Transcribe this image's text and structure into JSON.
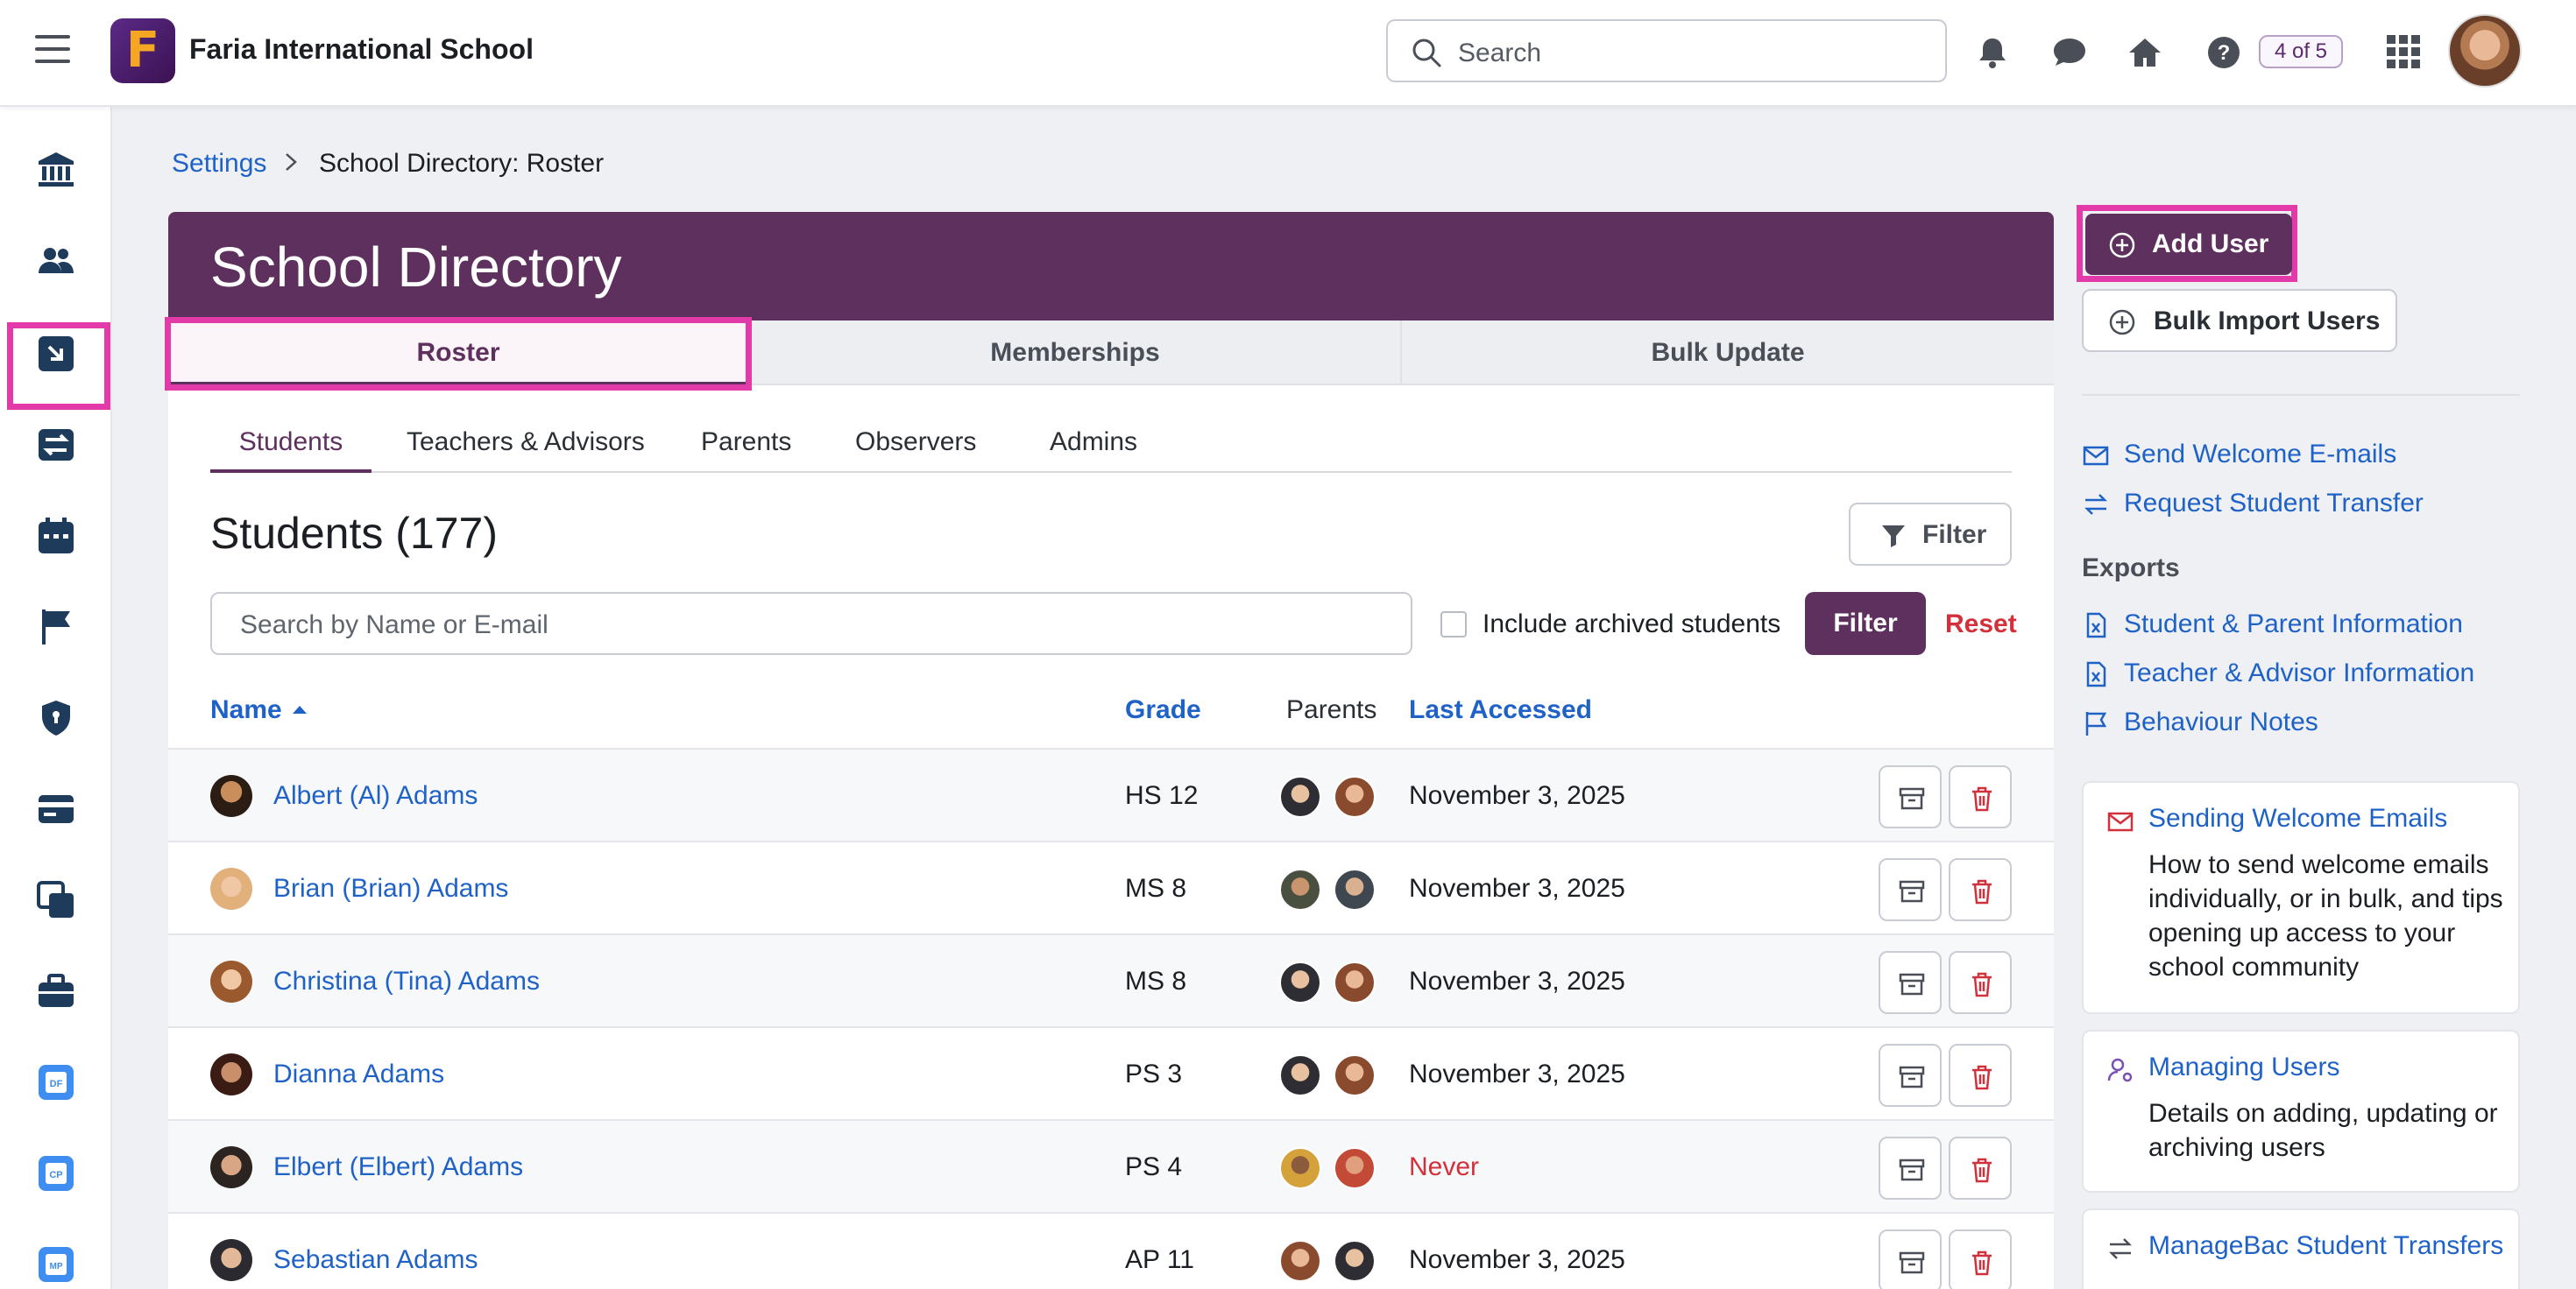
{
  "header": {
    "school_name": "Faria International School",
    "logo_letter": "F",
    "search_placeholder": "Search",
    "progress_badge": "4 of 5"
  },
  "breadcrumb": {
    "parent": "Settings",
    "current": "School Directory: Roster"
  },
  "directory": {
    "title": "School Directory",
    "tabs": [
      "Roster",
      "Memberships",
      "Bulk Update"
    ],
    "active_tab": "Roster",
    "subtabs": [
      "Students",
      "Teachers & Advisors",
      "Parents",
      "Observers",
      "Admins"
    ],
    "active_subtab": "Students",
    "heading": "Students (177)",
    "filter_button": "Filter",
    "search_placeholder": "Search by Name or E-mail",
    "include_archived_label": "Include archived students",
    "include_archived_checked": false,
    "apply_filter_button": "Filter",
    "reset_link": "Reset"
  },
  "table": {
    "columns": {
      "name": "Name",
      "grade": "Grade",
      "parents": "Parents",
      "last_accessed": "Last Accessed"
    },
    "sort": "name-ascending",
    "rows": [
      {
        "name": "Albert (Al) Adams",
        "grade": "HS 12",
        "last_accessed": "November 3, 2025",
        "never": false
      },
      {
        "name": "Brian (Brian) Adams",
        "grade": "MS 8",
        "last_accessed": "November 3, 2025",
        "never": false
      },
      {
        "name": "Christina (Tina) Adams",
        "grade": "MS 8",
        "last_accessed": "November 3, 2025",
        "never": false
      },
      {
        "name": "Dianna Adams",
        "grade": "PS 3",
        "last_accessed": "November 3, 2025",
        "never": false
      },
      {
        "name": "Elbert (Elbert) Adams",
        "grade": "PS 4",
        "last_accessed": "Never",
        "never": true
      },
      {
        "name": "Sebastian Adams",
        "grade": "AP 11",
        "last_accessed": "November 3, 2025",
        "never": false
      }
    ]
  },
  "sidebar_right": {
    "add_user": "Add User",
    "bulk_import": "Bulk Import Users",
    "actions": [
      "Send Welcome E-mails",
      "Request Student Transfer"
    ],
    "exports_label": "Exports",
    "exports": [
      "Student & Parent Information",
      "Teacher & Advisor Information",
      "Behaviour Notes"
    ],
    "help_cards": [
      {
        "title": "Sending Welcome Emails",
        "body": "How to send welcome emails individually, or in bulk, and tips opening up access to your school community"
      },
      {
        "title": "Managing Users",
        "body": "Details on adding, updating or archiving users"
      },
      {
        "title": "ManageBac Student Transfers",
        "body": ""
      }
    ]
  },
  "colors": {
    "brand": "#5e305e",
    "link": "#1f62c7",
    "danger": "#d2303a",
    "highlight": "#e23aa8"
  },
  "rail_icons": [
    "bank-icon",
    "users-icon",
    "arrow-in-icon",
    "transfer-icon",
    "calendar-icon",
    "flag-icon",
    "shield-icon",
    "card-icon",
    "copy-icon",
    "briefcase-icon",
    "app-df-icon",
    "app-cp-icon",
    "app-mp-icon"
  ]
}
